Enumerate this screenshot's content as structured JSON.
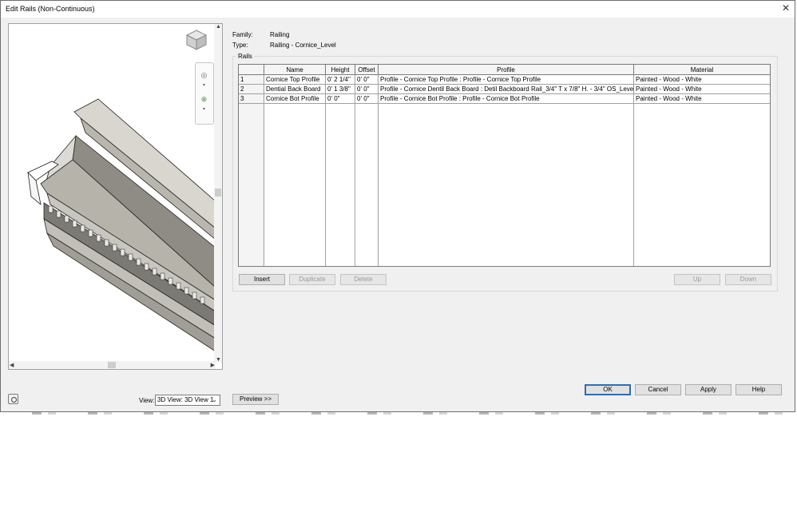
{
  "window": {
    "title": "Edit Rails (Non-Continuous)",
    "close_glyph": "✕"
  },
  "header": {
    "family_label": "Family:",
    "family_value": "Railing",
    "type_label": "Type:",
    "type_value": "Railing - Cornice_Level"
  },
  "rails": {
    "group_label": "Rails",
    "columns": [
      "Name",
      "Height",
      "Offset",
      "Profile",
      "Material"
    ],
    "rows": [
      {
        "num": "1",
        "name": "Cornice Top Profile",
        "height": "0'  2 1/4\"",
        "offset": "0'  0\"",
        "profile": "Profile - Cornice Top Profile : Profile - Cornice Top Profile",
        "material": "Painted - Wood - White"
      },
      {
        "num": "2",
        "name": "Dential Back Board",
        "height": "0'  1 3/8\"",
        "offset": "0'  0\"",
        "profile": "Profile - Cornice Dentil Back Board : Detil Backboard Rail_3/4\" T x 7/8\" H. - 3/4\" OS_Level",
        "material": "Painted - Wood - White"
      },
      {
        "num": "3",
        "name": "Cornice Bot Profile",
        "height": "0'  0\"",
        "offset": "0'  0\"",
        "profile": "Profile - Cornice Bot Profile : Profile - Cornice Bot Profile",
        "material": "Painted - Wood - White"
      }
    ]
  },
  "row_buttons": {
    "insert": "Insert",
    "duplicate": "Duplicate",
    "delete": "Delete",
    "up": "Up",
    "down": "Down"
  },
  "view": {
    "label": "View:",
    "selected": "3D View: 3D View 1"
  },
  "footer": {
    "preview": "Preview >>",
    "ok": "OK",
    "cancel": "Cancel",
    "apply": "Apply",
    "help": "Help"
  },
  "icons": [
    "close-icon",
    "viewcube-icon",
    "steering-wheel-icon",
    "zoom-icon",
    "camera-icon",
    "chevron-down-icon"
  ],
  "colors": {
    "dialog_bg": "#f0f0f0",
    "model_face": "#a7a49c",
    "model_dark": "#8a8780",
    "default_button_border": "#2d6db5"
  }
}
